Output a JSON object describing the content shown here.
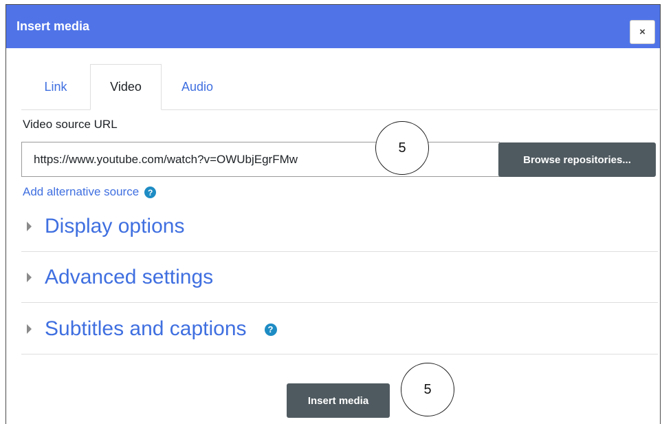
{
  "dialog": {
    "title": "Insert media",
    "close_label": "×"
  },
  "tabs": [
    {
      "label": "Link",
      "active": false
    },
    {
      "label": "Video",
      "active": true
    },
    {
      "label": "Audio",
      "active": false
    }
  ],
  "video": {
    "source_label": "Video source URL",
    "url_value": "https://www.youtube.com/watch?v=OWUbjEgrFMw",
    "browse_label": "Browse repositories...",
    "alt_source_label": "Add alternative source",
    "help_icon": "?"
  },
  "sections": [
    {
      "label": "Display options",
      "has_help": false
    },
    {
      "label": "Advanced settings",
      "has_help": false
    },
    {
      "label": "Subtitles and captions",
      "has_help": true
    }
  ],
  "footer": {
    "insert_label": "Insert media"
  },
  "annotations": [
    {
      "label": "5"
    },
    {
      "label": "5"
    }
  ],
  "colors": {
    "titlebar": "#5074e8",
    "link": "#3f6fe0",
    "button": "#4f5a60",
    "help": "#1e8cc4"
  },
  "icons": {
    "close": "close-icon",
    "help": "help-icon",
    "caret": "caret-right-icon"
  }
}
